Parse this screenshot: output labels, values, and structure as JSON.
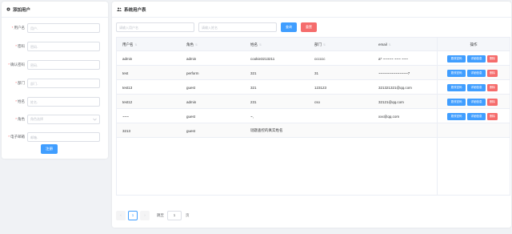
{
  "left_panel": {
    "title": "添加用户",
    "fields": [
      {
        "label": "用户名",
        "placeholder": "用户-",
        "required": true
      },
      {
        "label": "密码",
        "placeholder": "密码-",
        "required": true
      },
      {
        "label": "确认密码",
        "placeholder": "密码-",
        "required": true
      },
      {
        "label": "部门",
        "placeholder": "部门-",
        "required": true
      },
      {
        "label": "姓名",
        "placeholder": "姓名-",
        "required": true
      },
      {
        "label": "角色",
        "placeholder": "角色选择",
        "required": true,
        "type": "select"
      },
      {
        "label": "电子邮箱",
        "placeholder": "邮箱-",
        "required": true
      }
    ],
    "register_label": "注册"
  },
  "right_panel": {
    "title": "系统用户表",
    "search": {
      "username_placeholder": "请输入用户名",
      "name_placeholder": "请输入姓名",
      "query_label": "查询",
      "reset_label": "重置"
    },
    "table": {
      "columns": [
        "用户名",
        "角色",
        "姓名",
        "部门",
        "email",
        "操作"
      ],
      "rows": [
        {
          "username": "admin",
          "role": "admin",
          "name": "cookie3213211",
          "dept": "cccccc",
          "email": "a* ~~~~~ ~~~ ~~~"
        },
        {
          "username": "test",
          "role": "perform",
          "name": "321",
          "dept": "31",
          "email": "~~~~~~~~~~~~~~7"
        },
        {
          "username": "test13",
          "role": "guest",
          "name": "321",
          "dept": "123123",
          "email": "321321321@qq.com"
        },
        {
          "username": "test12",
          "role": "admin",
          "name": "231",
          "dept": "cso",
          "email": "32121@qq.com"
        },
        {
          "username": "~~~",
          "role": "guest",
          "name": "~,",
          "dept": "",
          "email": "xxx@qq.com"
        },
        {
          "username": "3213",
          "role": "guest",
          "name": "谜题查控的真实姓名",
          "dept": "",
          "email": ""
        }
      ],
      "actions": {
        "edit": "更改密码",
        "detail": "详细信息",
        "delete": "删除"
      }
    },
    "pagination": {
      "current_page": "1",
      "goto_label": "跳至",
      "goto_value": "1",
      "page_suffix": "页",
      "prev": "‹",
      "next": "›"
    }
  },
  "colors": {
    "primary": "#409eff",
    "danger": "#f56c6c",
    "background": "#f0f2f5"
  }
}
